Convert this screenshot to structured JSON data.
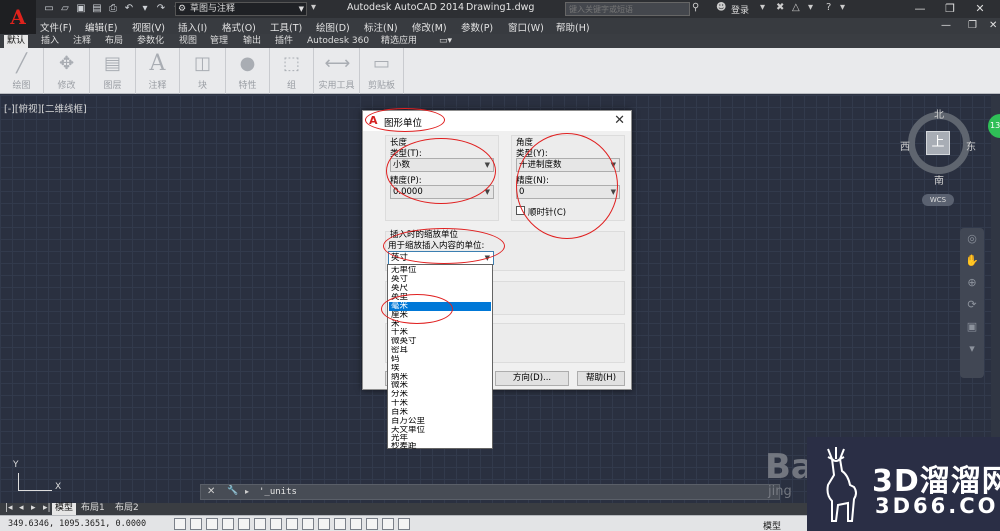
{
  "titlebar": {
    "workspace": "草图与注释",
    "app_title": "Autodesk AutoCAD 2014",
    "doc_title": "Drawing1.dwg",
    "search_placeholder": "键入关键字或短语",
    "login_label": "登录"
  },
  "menubar": [
    "文件(F)",
    "编辑(E)",
    "视图(V)",
    "插入(I)",
    "格式(O)",
    "工具(T)",
    "绘图(D)",
    "标注(N)",
    "修改(M)",
    "参数(P)",
    "窗口(W)",
    "帮助(H)"
  ],
  "ribbon_tabs": [
    "默认",
    "插入",
    "注释",
    "布局",
    "参数化",
    "视图",
    "管理",
    "输出",
    "插件",
    "Autodesk 360",
    "精选应用"
  ],
  "ribbon_groups": [
    {
      "label": "绘图",
      "icon": "line-icon"
    },
    {
      "label": "修改",
      "icon": "move-icon"
    },
    {
      "label": "图层",
      "icon": "layers-icon"
    },
    {
      "label": "注释",
      "icon": "text-icon"
    },
    {
      "label": "块",
      "icon": "block-icon"
    },
    {
      "label": "特性",
      "icon": "properties-icon"
    },
    {
      "label": "组",
      "icon": "group-icon"
    },
    {
      "label": "实用工具",
      "icon": "measure-icon"
    },
    {
      "label": "剪贴板",
      "icon": "clipboard-icon"
    }
  ],
  "viewport_label": "[-][俯视][二维线框]",
  "viewcube": {
    "north": "北",
    "south": "南",
    "west": "西",
    "east": "东",
    "face": "上",
    "wcs": "WCS"
  },
  "ucs": {
    "y": "Y",
    "x": "X"
  },
  "dialog": {
    "title": "图形单位",
    "length": {
      "group": "长度",
      "type_label": "类型(T):",
      "type_value": "小数",
      "precision_label": "精度(P):",
      "precision_value": "0.0000"
    },
    "angle": {
      "group": "角度",
      "type_label": "类型(Y):",
      "type_value": "十进制度数",
      "precision_label": "精度(N):",
      "precision_value": "0",
      "clockwise_label": "顺时针(C)"
    },
    "insert_scale": {
      "group": "插入时的缩放单位",
      "desc": "用于缩放插入内容的单位:",
      "value": "英寸"
    },
    "buttons": {
      "direction": "方向(D)...",
      "help": "帮助(H)"
    }
  },
  "unit_options": [
    "无单位",
    "英寸",
    "英尺",
    "英里",
    "毫米",
    "厘米",
    "米",
    "千米",
    "微英寸",
    "密耳",
    "码",
    "埃",
    "纳米",
    "微米",
    "分米",
    "十米",
    "百米",
    "百万公里",
    "天文单位",
    "光年",
    "秒差距"
  ],
  "unit_selected": "毫米",
  "command_line": {
    "text": "'_units"
  },
  "layout_tabs": [
    "模型",
    "布局1",
    "布局2"
  ],
  "status": {
    "coords": "349.6346,  1095.3651, 0.0000",
    "model": "模型"
  },
  "watermark": {
    "cn": "3D溜溜网",
    "en": "3D66.COM",
    "baidu": "Bai",
    "baidu_sub": "jing"
  }
}
